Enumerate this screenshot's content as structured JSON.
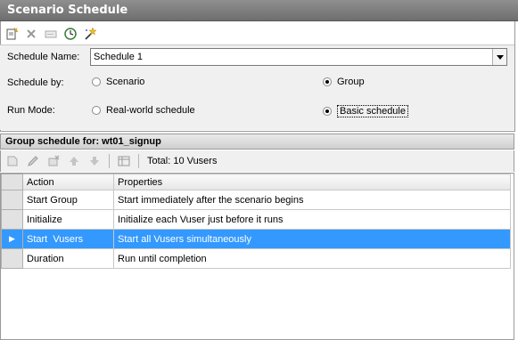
{
  "window": {
    "title": "Scenario Schedule"
  },
  "toolbar": {
    "icons": [
      "new-schedule-icon",
      "delete-icon",
      "rename-icon",
      "time-icon",
      "wizard-icon"
    ]
  },
  "form": {
    "schedule_name_label": "Schedule Name:",
    "schedule_name_value": "Schedule 1",
    "schedule_by_label": "Schedule by:",
    "schedule_by_options": [
      {
        "label": "Scenario",
        "checked": false
      },
      {
        "label": "Group",
        "checked": true
      }
    ],
    "run_mode_label": "Run Mode:",
    "run_mode_options": [
      {
        "label": "Real-world schedule",
        "checked": false
      },
      {
        "label": "Basic schedule",
        "checked": true
      }
    ]
  },
  "group": {
    "header": "Group schedule for: wt01_signup",
    "total": "Total: 10 Vusers"
  },
  "grid": {
    "columns": [
      "Action",
      "Properties"
    ],
    "rows": [
      {
        "action": "Start Group",
        "properties": "Start immediately after the scenario begins",
        "selected": false
      },
      {
        "action": "Initialize",
        "properties": "Initialize each Vuser just before it runs",
        "selected": false
      },
      {
        "action": "Start  Vusers",
        "properties": "Start all Vusers simultaneously",
        "selected": true
      },
      {
        "action": "Duration",
        "properties": "Run until completion",
        "selected": false
      }
    ],
    "selected_marker": "▶"
  },
  "colors": {
    "selection": "#3399ff",
    "title_bar": "#7a7a7a"
  }
}
